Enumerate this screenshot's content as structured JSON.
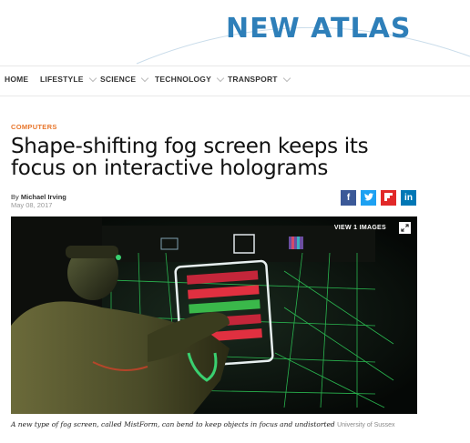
{
  "header": {
    "logo": "NEW ATLAS"
  },
  "nav": {
    "items": [
      {
        "label": "HOME",
        "has_dropdown": false
      },
      {
        "label": "LIFESTYLE",
        "has_dropdown": true
      },
      {
        "label": "SCIENCE",
        "has_dropdown": true
      },
      {
        "label": "TECHNOLOGY",
        "has_dropdown": true
      },
      {
        "label": "TRANSPORT",
        "has_dropdown": true
      }
    ]
  },
  "article": {
    "category": "COMPUTERS",
    "title": "Shape-shifting fog screen keeps its focus on interactive holograms",
    "author_prefix": "By",
    "author": "Michael Irving",
    "date": "May 08, 2017",
    "share": [
      {
        "name": "facebook-icon",
        "glyph": "f",
        "color": "#3b5998"
      },
      {
        "name": "twitter-icon",
        "glyph": "t",
        "color": "#1da1f2"
      },
      {
        "name": "flipboard-icon",
        "glyph": "F",
        "color": "#e12828"
      },
      {
        "name": "linkedin-icon",
        "glyph": "in",
        "color": "#0077b5"
      }
    ],
    "image": {
      "view_label": "VIEW 1 IMAGES"
    },
    "caption": "A new type of fog screen, called MistForm, can bend to keep objects in focus and undistorted",
    "credit": "University of Sussex"
  },
  "colors": {
    "accent": "#e8762c",
    "logo": "#2e7fb9"
  }
}
